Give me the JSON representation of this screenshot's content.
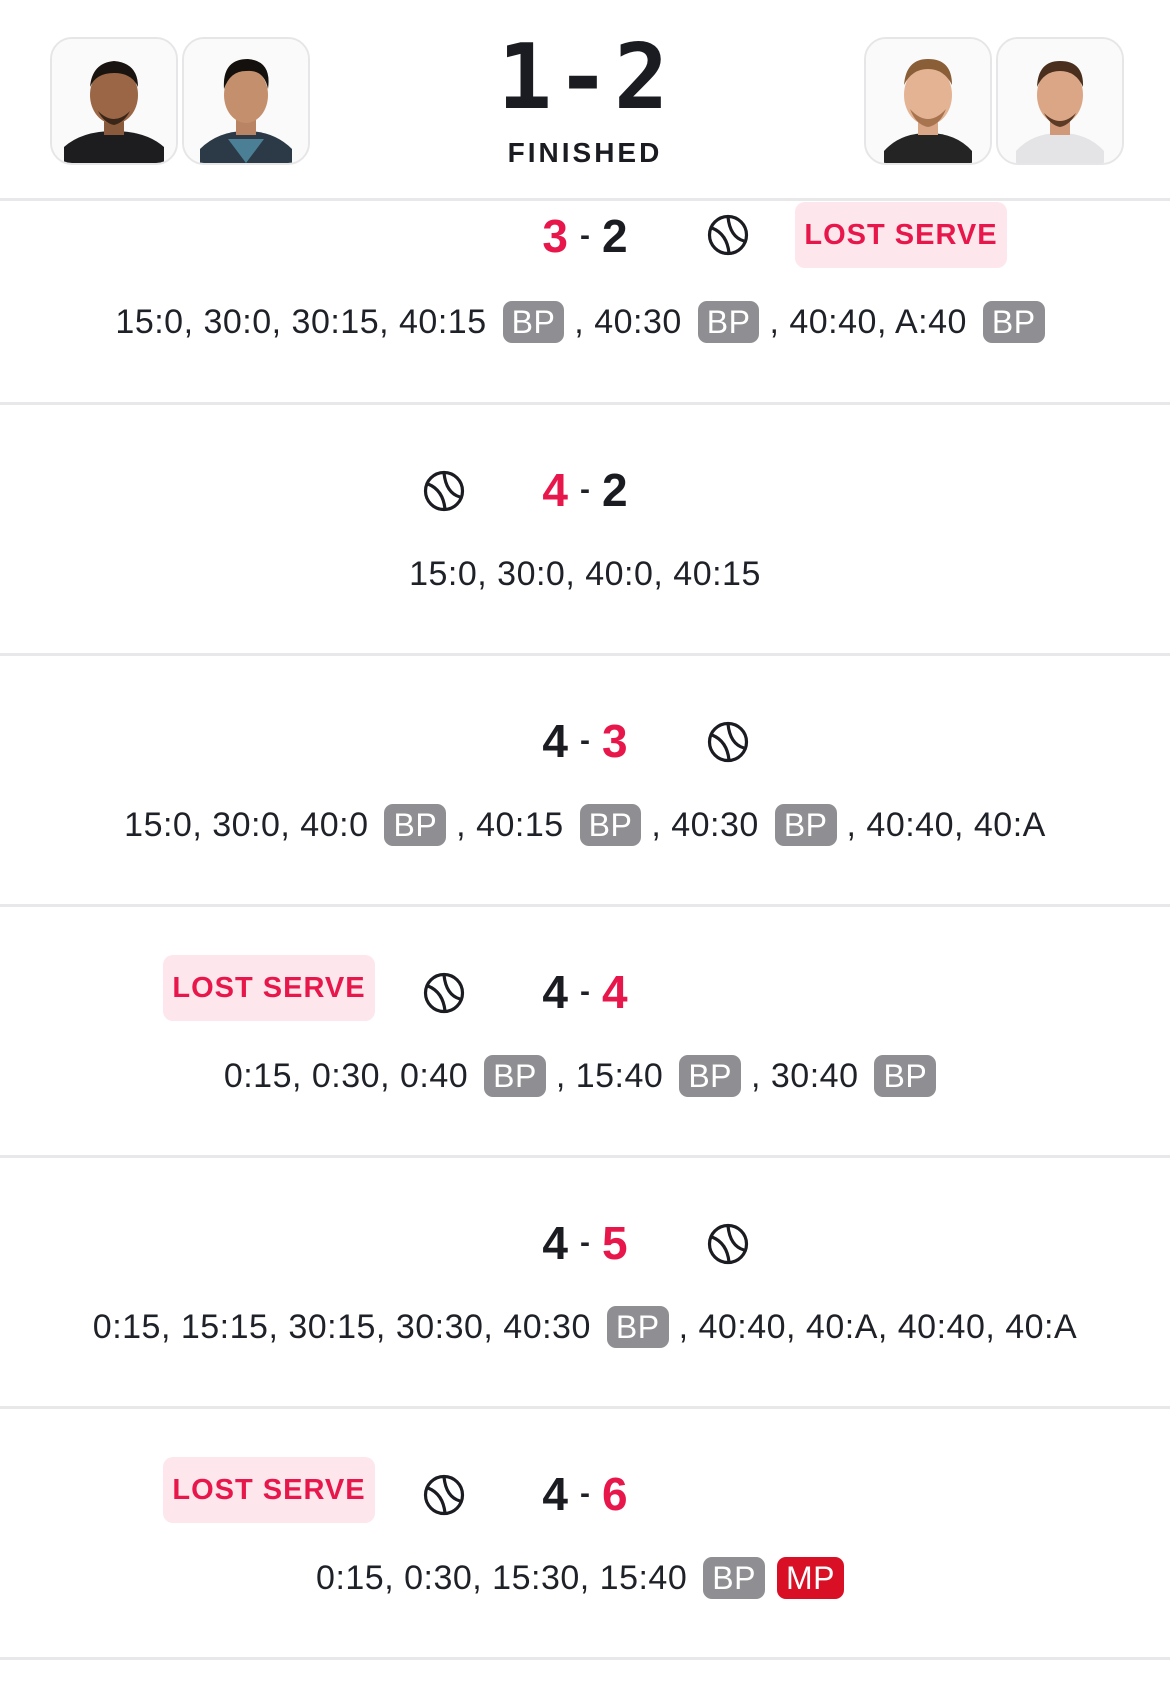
{
  "match": {
    "score": "1-2",
    "status": "FINISHED",
    "home_avatars": [
      "player-avatar-home-1",
      "player-avatar-home-2"
    ],
    "away_avatars": [
      "player-avatar-away-1",
      "player-avatar-away-2"
    ]
  },
  "colors": {
    "winner": "#e8174b",
    "badge_bg": "#fde6ec",
    "bp_tag": "#8f8f93",
    "mp_tag": "#d90f25"
  },
  "games": [
    {
      "home": "3",
      "away": "2",
      "winner": "home",
      "server": "away",
      "lost_serve": "away",
      "lost_serve_label": "LOST SERVE",
      "points": [
        {
          "text": "15:0, 30:0, 30:15, 40:15",
          "tags": [
            "BP"
          ]
        },
        {
          "text": ", 40:30",
          "tags": [
            "BP"
          ]
        },
        {
          "text": ", 40:40, A:40",
          "tags": [
            "BP"
          ]
        }
      ]
    },
    {
      "home": "4",
      "away": "2",
      "winner": "home",
      "server": "home",
      "lost_serve": null,
      "points": [
        {
          "text": "15:0, 30:0, 40:0, 40:15",
          "tags": []
        }
      ]
    },
    {
      "home": "4",
      "away": "3",
      "winner": "away",
      "server": "away",
      "lost_serve": null,
      "points": [
        {
          "text": "15:0, 30:0, 40:0",
          "tags": [
            "BP"
          ]
        },
        {
          "text": ", 40:15",
          "tags": [
            "BP"
          ]
        },
        {
          "text": ", 40:30",
          "tags": [
            "BP"
          ]
        },
        {
          "text": ", 40:40, 40:A",
          "tags": []
        }
      ]
    },
    {
      "home": "4",
      "away": "4",
      "winner": "away",
      "server": "home",
      "lost_serve": "home",
      "lost_serve_label": "LOST SERVE",
      "points": [
        {
          "text": "0:15, 0:30, 0:40",
          "tags": [
            "BP"
          ]
        },
        {
          "text": ", 15:40",
          "tags": [
            "BP"
          ]
        },
        {
          "text": ", 30:40",
          "tags": [
            "BP"
          ]
        }
      ]
    },
    {
      "home": "4",
      "away": "5",
      "winner": "away",
      "server": "away",
      "lost_serve": null,
      "points": [
        {
          "text": "0:15, 15:15, 30:15, 30:30, 40:30",
          "tags": [
            "BP"
          ]
        },
        {
          "text": ", 40:40, 40:A, 40:40, 40:A",
          "tags": []
        }
      ]
    },
    {
      "home": "4",
      "away": "6",
      "winner": "away",
      "server": "home",
      "lost_serve": "home",
      "lost_serve_label": "LOST SERVE",
      "points": [
        {
          "text": "0:15, 0:30, 15:30, 15:40",
          "tags": [
            "BP",
            "MP"
          ]
        }
      ]
    }
  ]
}
